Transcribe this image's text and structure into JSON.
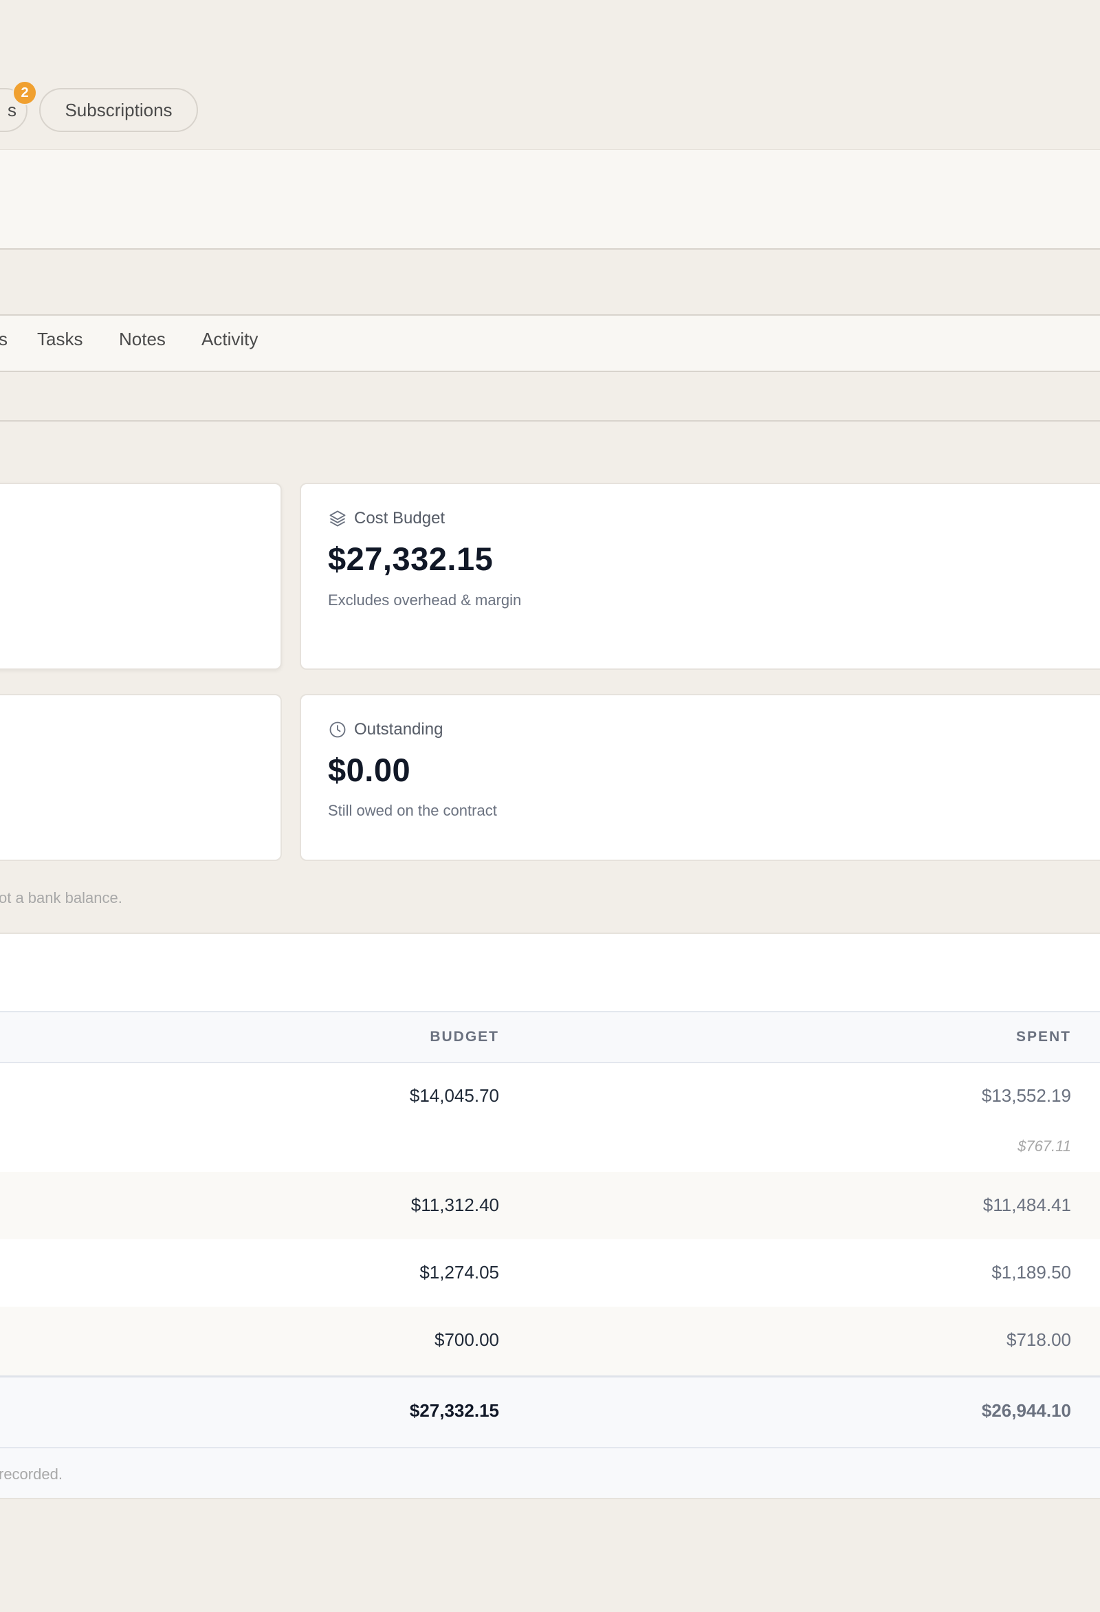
{
  "top_tabs": {
    "partial_label": "s",
    "partial_badge": "2",
    "subscriptions_label": "Subscriptions"
  },
  "page_tabs": {
    "partial_label": "s",
    "items": [
      "Tasks",
      "Notes",
      "Activity"
    ]
  },
  "cards": {
    "cost_budget": {
      "label": "Cost Budget",
      "value": "$27,332.15",
      "sub": "Excludes overhead & margin"
    },
    "outstanding": {
      "label": "Outstanding",
      "value": "$0.00",
      "sub": "Still owed on the contract"
    },
    "disclaimer": "ot a bank balance."
  },
  "table": {
    "headers": {
      "budget": "BUDGET",
      "spent": "SPENT"
    },
    "rows": [
      {
        "budget": "$14,045.70",
        "spent": "$13,552.19",
        "sub": "$767.11"
      },
      {
        "budget": "$11,312.40",
        "spent": "$11,484.41"
      },
      {
        "budget": "$1,274.05",
        "spent": "$1,189.50"
      },
      {
        "budget": "$700.00",
        "spent": "$718.00"
      }
    ],
    "total": {
      "budget": "$27,332.15",
      "spent": "$26,944.10"
    },
    "footer": "recorded."
  },
  "colors": {
    "background": "#f2eee8",
    "badge": "#f0a030",
    "card": "#ffffff"
  }
}
